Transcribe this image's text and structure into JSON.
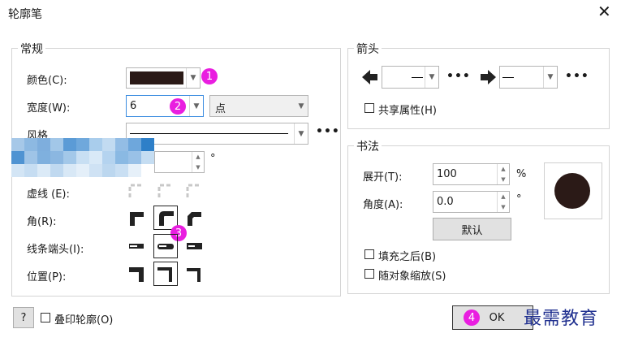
{
  "title": "轮廓笔",
  "general": {
    "group_label": "常规",
    "color_label": "颜色(C):",
    "color_value": "#2b1a17",
    "width_label": "宽度(W):",
    "width_value": "6",
    "unit_value": "点",
    "style_label": "风格",
    "dash_label": "虚线 (E):",
    "corner_label": "角(R):",
    "cap_label": "线条端头(I):",
    "position_label": "位置(P):",
    "degree_symbol": "°"
  },
  "arrows": {
    "group_label": "箭头",
    "share_label": "共享属性(H)"
  },
  "calligraphy": {
    "group_label": "书法",
    "stretch_label": "展开(T):",
    "stretch_value": "100",
    "stretch_unit": "%",
    "angle_label": "角度(A):",
    "angle_value": "0.0",
    "angle_unit": "°",
    "default_button": "默认",
    "fill_behind_label": "填充之后(B)",
    "scale_label": "随对象缩放(S)"
  },
  "footer": {
    "help_button": "?",
    "overprint_label": "叠印轮廓(O)",
    "ok_button": "OK"
  },
  "badges": [
    "1",
    "2",
    "3",
    "4"
  ],
  "watermark": "最需教育"
}
